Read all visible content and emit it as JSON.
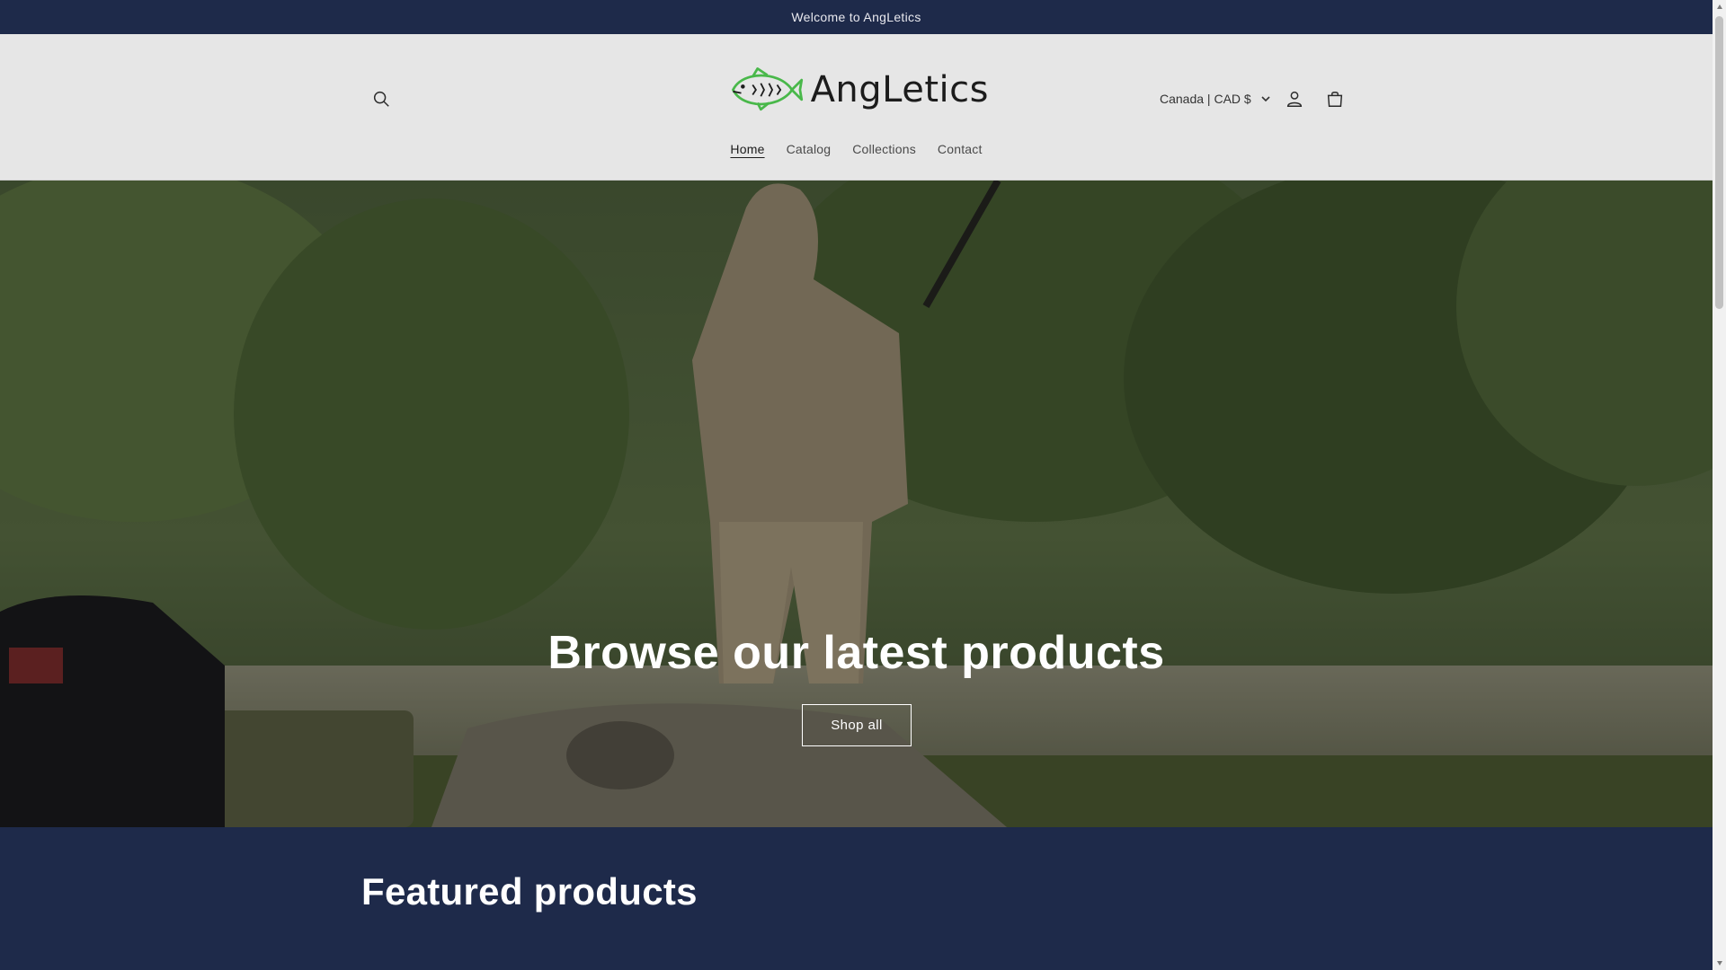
{
  "announcement": {
    "text": "Welcome to AngLetics"
  },
  "header": {
    "logo_text": "AngLetics",
    "country_selector": "Canada | CAD $",
    "nav": [
      {
        "label": "Home",
        "active": true
      },
      {
        "label": "Catalog",
        "active": false
      },
      {
        "label": "Collections",
        "active": false
      },
      {
        "label": "Contact",
        "active": false
      }
    ]
  },
  "hero": {
    "title": "Browse our latest products",
    "button_label": "Shop all"
  },
  "featured": {
    "title": "Featured products"
  },
  "icons": {
    "search": "search-icon",
    "account": "user-icon",
    "cart": "shopping-bag-icon",
    "chevron": "chevron-down-icon",
    "logo": "fish-logo-icon"
  },
  "colors": {
    "navy": "#1e2a4a",
    "header_bg": "#e6e6e6",
    "logo_green": "#49b84a"
  }
}
